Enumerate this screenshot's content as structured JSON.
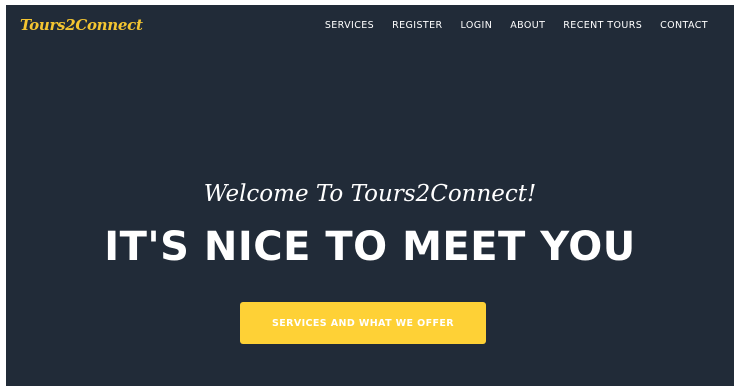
{
  "navbar": {
    "brand": "Tours2Connect",
    "links": [
      {
        "label": "SERVICES"
      },
      {
        "label": "REGISTER"
      },
      {
        "label": "LOGIN"
      },
      {
        "label": "ABOUT"
      },
      {
        "label": "RECENT TOURS"
      },
      {
        "label": "CONTACT"
      }
    ]
  },
  "hero": {
    "subheading": "Welcome To Tours2Connect!",
    "heading": "IT'S NICE TO MEET YOU",
    "cta_label": "SERVICES AND WHAT WE OFFER"
  },
  "colors": {
    "background": "#212b38",
    "accent": "#fed136",
    "brand": "#f4c531",
    "text": "#ffffff"
  }
}
